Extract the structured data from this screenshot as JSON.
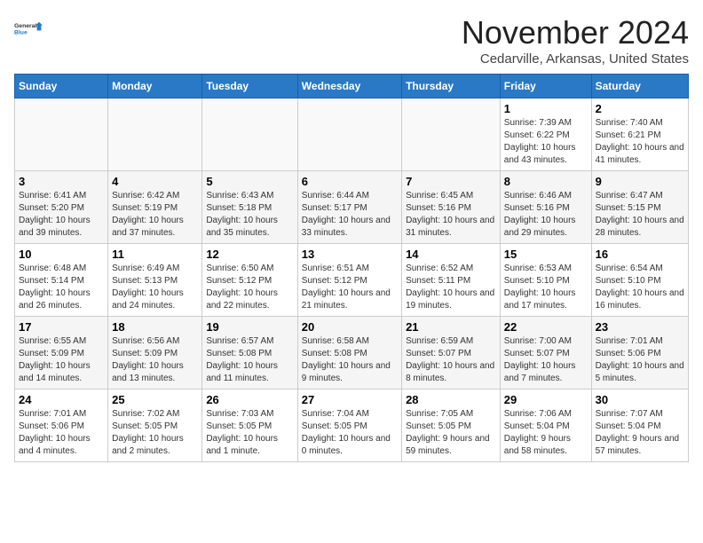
{
  "logo": {
    "general": "General",
    "blue": "Blue"
  },
  "title": "November 2024",
  "location": "Cedarville, Arkansas, United States",
  "weekdays": [
    "Sunday",
    "Monday",
    "Tuesday",
    "Wednesday",
    "Thursday",
    "Friday",
    "Saturday"
  ],
  "weeks": [
    [
      {
        "day": "",
        "info": ""
      },
      {
        "day": "",
        "info": ""
      },
      {
        "day": "",
        "info": ""
      },
      {
        "day": "",
        "info": ""
      },
      {
        "day": "",
        "info": ""
      },
      {
        "day": "1",
        "info": "Sunrise: 7:39 AM\nSunset: 6:22 PM\nDaylight: 10 hours and 43 minutes."
      },
      {
        "day": "2",
        "info": "Sunrise: 7:40 AM\nSunset: 6:21 PM\nDaylight: 10 hours and 41 minutes."
      }
    ],
    [
      {
        "day": "3",
        "info": "Sunrise: 6:41 AM\nSunset: 5:20 PM\nDaylight: 10 hours and 39 minutes."
      },
      {
        "day": "4",
        "info": "Sunrise: 6:42 AM\nSunset: 5:19 PM\nDaylight: 10 hours and 37 minutes."
      },
      {
        "day": "5",
        "info": "Sunrise: 6:43 AM\nSunset: 5:18 PM\nDaylight: 10 hours and 35 minutes."
      },
      {
        "day": "6",
        "info": "Sunrise: 6:44 AM\nSunset: 5:17 PM\nDaylight: 10 hours and 33 minutes."
      },
      {
        "day": "7",
        "info": "Sunrise: 6:45 AM\nSunset: 5:16 PM\nDaylight: 10 hours and 31 minutes."
      },
      {
        "day": "8",
        "info": "Sunrise: 6:46 AM\nSunset: 5:16 PM\nDaylight: 10 hours and 29 minutes."
      },
      {
        "day": "9",
        "info": "Sunrise: 6:47 AM\nSunset: 5:15 PM\nDaylight: 10 hours and 28 minutes."
      }
    ],
    [
      {
        "day": "10",
        "info": "Sunrise: 6:48 AM\nSunset: 5:14 PM\nDaylight: 10 hours and 26 minutes."
      },
      {
        "day": "11",
        "info": "Sunrise: 6:49 AM\nSunset: 5:13 PM\nDaylight: 10 hours and 24 minutes."
      },
      {
        "day": "12",
        "info": "Sunrise: 6:50 AM\nSunset: 5:12 PM\nDaylight: 10 hours and 22 minutes."
      },
      {
        "day": "13",
        "info": "Sunrise: 6:51 AM\nSunset: 5:12 PM\nDaylight: 10 hours and 21 minutes."
      },
      {
        "day": "14",
        "info": "Sunrise: 6:52 AM\nSunset: 5:11 PM\nDaylight: 10 hours and 19 minutes."
      },
      {
        "day": "15",
        "info": "Sunrise: 6:53 AM\nSunset: 5:10 PM\nDaylight: 10 hours and 17 minutes."
      },
      {
        "day": "16",
        "info": "Sunrise: 6:54 AM\nSunset: 5:10 PM\nDaylight: 10 hours and 16 minutes."
      }
    ],
    [
      {
        "day": "17",
        "info": "Sunrise: 6:55 AM\nSunset: 5:09 PM\nDaylight: 10 hours and 14 minutes."
      },
      {
        "day": "18",
        "info": "Sunrise: 6:56 AM\nSunset: 5:09 PM\nDaylight: 10 hours and 13 minutes."
      },
      {
        "day": "19",
        "info": "Sunrise: 6:57 AM\nSunset: 5:08 PM\nDaylight: 10 hours and 11 minutes."
      },
      {
        "day": "20",
        "info": "Sunrise: 6:58 AM\nSunset: 5:08 PM\nDaylight: 10 hours and 9 minutes."
      },
      {
        "day": "21",
        "info": "Sunrise: 6:59 AM\nSunset: 5:07 PM\nDaylight: 10 hours and 8 minutes."
      },
      {
        "day": "22",
        "info": "Sunrise: 7:00 AM\nSunset: 5:07 PM\nDaylight: 10 hours and 7 minutes."
      },
      {
        "day": "23",
        "info": "Sunrise: 7:01 AM\nSunset: 5:06 PM\nDaylight: 10 hours and 5 minutes."
      }
    ],
    [
      {
        "day": "24",
        "info": "Sunrise: 7:01 AM\nSunset: 5:06 PM\nDaylight: 10 hours and 4 minutes."
      },
      {
        "day": "25",
        "info": "Sunrise: 7:02 AM\nSunset: 5:05 PM\nDaylight: 10 hours and 2 minutes."
      },
      {
        "day": "26",
        "info": "Sunrise: 7:03 AM\nSunset: 5:05 PM\nDaylight: 10 hours and 1 minute."
      },
      {
        "day": "27",
        "info": "Sunrise: 7:04 AM\nSunset: 5:05 PM\nDaylight: 10 hours and 0 minutes."
      },
      {
        "day": "28",
        "info": "Sunrise: 7:05 AM\nSunset: 5:05 PM\nDaylight: 9 hours and 59 minutes."
      },
      {
        "day": "29",
        "info": "Sunrise: 7:06 AM\nSunset: 5:04 PM\nDaylight: 9 hours and 58 minutes."
      },
      {
        "day": "30",
        "info": "Sunrise: 7:07 AM\nSunset: 5:04 PM\nDaylight: 9 hours and 57 minutes."
      }
    ]
  ]
}
